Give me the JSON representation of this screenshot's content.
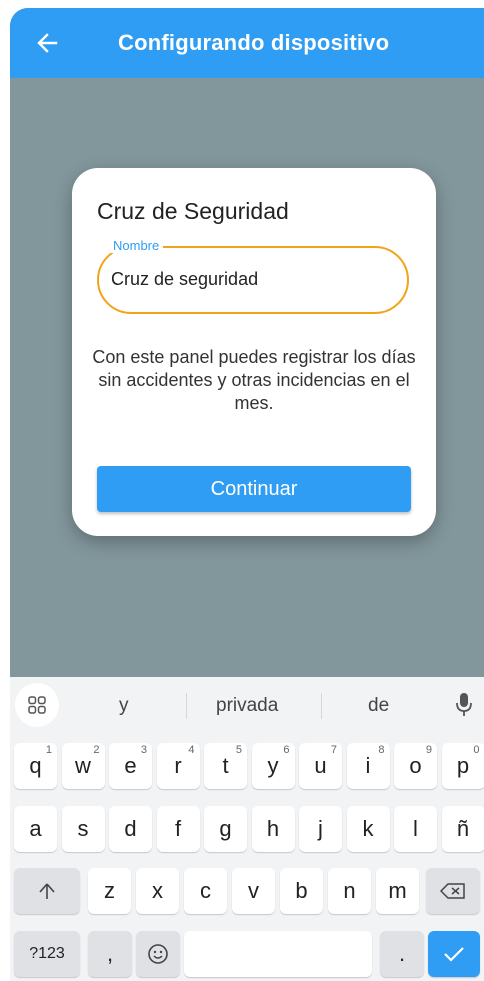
{
  "appbar": {
    "title": "Configurando dispositivo",
    "back_icon": "arrow-left-icon"
  },
  "dialog": {
    "title": "Cruz de Seguridad",
    "field_label": "Nombre",
    "field_value": "Cruz de seguridad",
    "description": "Con este panel puedes registrar los días sin accidentes y otras incidencias en el mes.",
    "button_label": "Continuar"
  },
  "keyboard": {
    "suggestions": [
      "y",
      "privada",
      "de"
    ],
    "row1": [
      {
        "k": "q",
        "h": "1"
      },
      {
        "k": "w",
        "h": "2"
      },
      {
        "k": "e",
        "h": "3"
      },
      {
        "k": "r",
        "h": "4"
      },
      {
        "k": "t",
        "h": "5"
      },
      {
        "k": "y",
        "h": "6"
      },
      {
        "k": "u",
        "h": "7"
      },
      {
        "k": "i",
        "h": "8"
      },
      {
        "k": "o",
        "h": "9"
      },
      {
        "k": "p",
        "h": "0"
      }
    ],
    "row2": [
      "a",
      "s",
      "d",
      "f",
      "g",
      "h",
      "j",
      "k",
      "l",
      "ñ"
    ],
    "row3": [
      "z",
      "x",
      "c",
      "v",
      "b",
      "n",
      "m"
    ],
    "symbols_label": "?123",
    "comma_label": ",",
    "period_label": "."
  },
  "colors": {
    "primary": "#2f9df3",
    "overlay": "#82979c",
    "field_outline": "#f2a31a"
  }
}
